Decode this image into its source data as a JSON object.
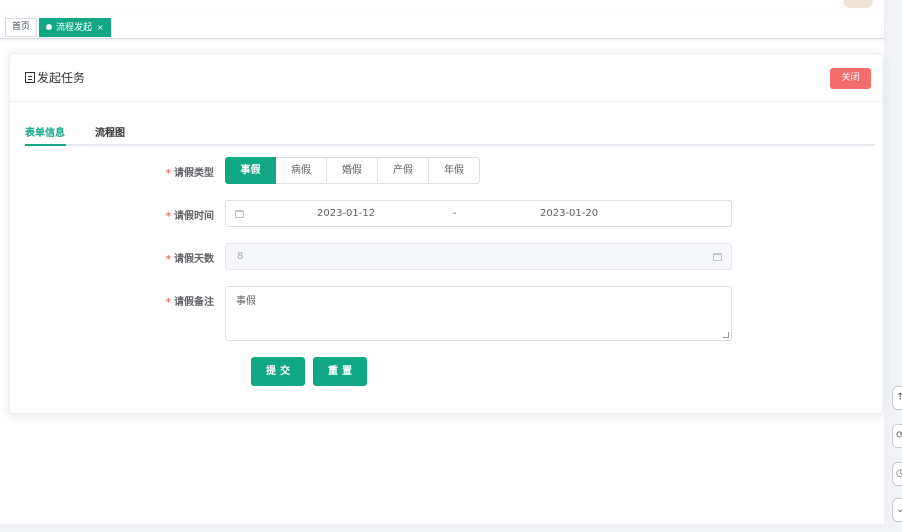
{
  "tags": {
    "home": "首页",
    "active": "流程发起",
    "close_glyph": "×"
  },
  "header": {
    "title": "发起任务",
    "close_label": "关闭"
  },
  "tabs": [
    {
      "label": "表单信息",
      "active": true
    },
    {
      "label": "流程图",
      "active": false
    }
  ],
  "form": {
    "required_mark": "*",
    "leave_type": {
      "label": "请假类型",
      "options": [
        "事假",
        "病假",
        "婚假",
        "产假",
        "年假"
      ],
      "selected": "事假"
    },
    "leave_time": {
      "label": "请假时间",
      "start": "2023-01-12",
      "separator": "-",
      "end": "2023-01-20"
    },
    "leave_days": {
      "label": "请假天数",
      "value": "8"
    },
    "leave_remark": {
      "label": "请假备注",
      "value": "事假"
    },
    "submit_label": "提交",
    "reset_label": "重置"
  },
  "colors": {
    "primary": "#11a983",
    "danger": "#f56c6c"
  },
  "icons": [
    "document-icon",
    "calendar-icon",
    "close-icon"
  ]
}
